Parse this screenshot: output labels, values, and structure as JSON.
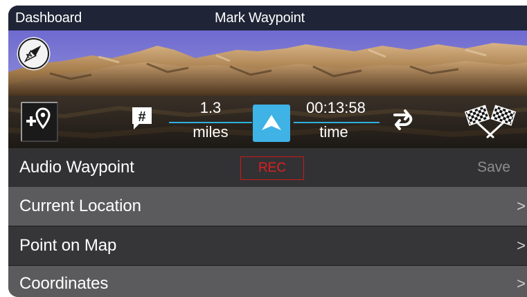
{
  "topbar": {
    "back_label": "Dashboard",
    "title": "Mark Waypoint"
  },
  "scene": {
    "sky_color": "#7872c8",
    "terrain_color": "#b98f5e",
    "compass_icon": "compass-icon"
  },
  "nav": {
    "distance_value": "1.3",
    "distance_unit": "miles",
    "time_value": "00:13:58",
    "time_unit": "time",
    "accent_color": "#3fb2e6",
    "icons": [
      "add-waypoint-icon",
      "hash-note-icon",
      "navigate-arrow-icon",
      "reverse-route-icon",
      "checkered-flags-icon"
    ]
  },
  "audio": {
    "label": "Audio Waypoint",
    "rec_label": "REC",
    "save_label": "Save",
    "rec_color": "#e01e1e"
  },
  "options": [
    {
      "label": "Current Location",
      "chevron": ">"
    },
    {
      "label": "Point on Map",
      "chevron": ">"
    },
    {
      "label": "Coordinates",
      "chevron": ">"
    }
  ]
}
